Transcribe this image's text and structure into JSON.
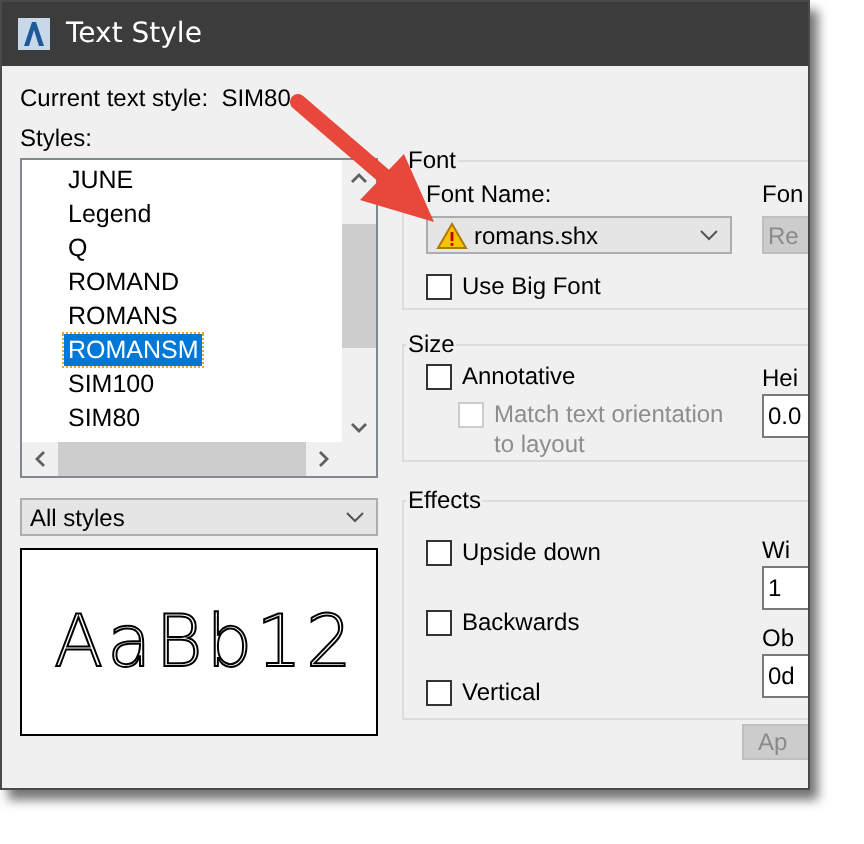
{
  "window": {
    "title": "Text Style"
  },
  "current_style": {
    "label": "Current text style:",
    "value": "SIM80"
  },
  "styles": {
    "label": "Styles:",
    "items": [
      {
        "name": "JUNE",
        "selected": false
      },
      {
        "name": "Legend",
        "selected": false
      },
      {
        "name": "Q",
        "selected": false
      },
      {
        "name": "ROMAND",
        "selected": false
      },
      {
        "name": "ROMANS",
        "selected": false
      },
      {
        "name": "ROMANSM",
        "selected": true
      },
      {
        "name": "SIM100",
        "selected": false
      },
      {
        "name": "SIM80",
        "selected": false
      }
    ]
  },
  "filter": {
    "value": "All styles"
  },
  "preview": {
    "text": "AaBb12"
  },
  "font": {
    "legend": "Font",
    "name_label": "Font Name:",
    "font_name": "romans.shx",
    "use_big_font": {
      "label": "Use Big Font",
      "checked": false
    },
    "column_2_label": "Fon",
    "column_2_button": "Re"
  },
  "size": {
    "legend": "Size",
    "annotative": {
      "label": "Annotative",
      "checked": false
    },
    "match": {
      "label": "Match text orientation to layout",
      "checked": false,
      "disabled": true
    },
    "column_2_label": "Hei",
    "column_2_value": "0.0"
  },
  "effects": {
    "legend": "Effects",
    "options": [
      {
        "label": "Upside down",
        "checked": false
      },
      {
        "label": "Backwards",
        "checked": false
      },
      {
        "label": "Vertical",
        "checked": false
      }
    ],
    "column_2": [
      {
        "label": "Wi",
        "value": "1"
      },
      {
        "label": "Ob",
        "value": "0d"
      }
    ]
  },
  "apply_button": {
    "label": "Ap",
    "disabled": true
  }
}
